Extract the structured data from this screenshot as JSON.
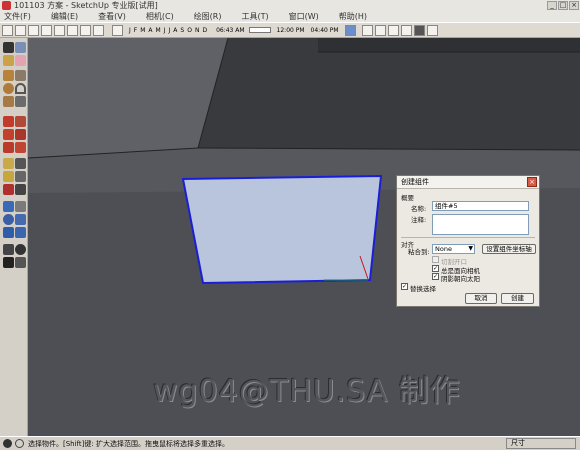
{
  "window": {
    "title": "101103 方案 - SketchUp 专业版[试用]",
    "controls": [
      "_",
      "□",
      "×"
    ]
  },
  "menu": [
    "文件(F)",
    "编辑(E)",
    "查看(V)",
    "相机(C)",
    "绘图(R)",
    "工具(T)",
    "窗口(W)",
    "帮助(H)"
  ],
  "toolbar": {
    "months": [
      "J",
      "F",
      "M",
      "A",
      "M",
      "J",
      "J",
      "A",
      "S",
      "O",
      "N",
      "D"
    ],
    "time_start": "06:43 AM",
    "noon": "12:00 PM",
    "time_end": "04:40 PM"
  },
  "dialog": {
    "title": "创建组件",
    "close": "×",
    "general_label": "概要",
    "name_label": "名称:",
    "name_value": "组件#5",
    "description_label": "注释:",
    "description_value": "",
    "alignment_label": "对齐",
    "glue_to_label": "粘合到:",
    "glue_to_value": "None",
    "set_axes_button": "设置组件坐标轴",
    "cut_opening": "切割开口",
    "always_face_camera": "总是面向相机",
    "shadows_face_sun": "阴影朝向太阳",
    "replace_selection": "替换选择",
    "cancel_button": "取消",
    "create_button": "创建",
    "checks": {
      "cut_opening": false,
      "always_face_camera": true,
      "shadows_face_sun": true,
      "replace_selection": true
    }
  },
  "status": {
    "hint": "选择物件。[Shift]键: 扩大选择范围。拖曳鼠标将选择多重选择。",
    "measurements_label": "尺寸"
  },
  "watermark": "wg04@THU.SA 制作",
  "colors": {
    "viewport_bg": "#4d4f54",
    "selected_face": "#b9c5dd",
    "selection_edge": "#1a1fd6",
    "axis_red": "#c01818",
    "axis_green": "#1f8a1f"
  }
}
